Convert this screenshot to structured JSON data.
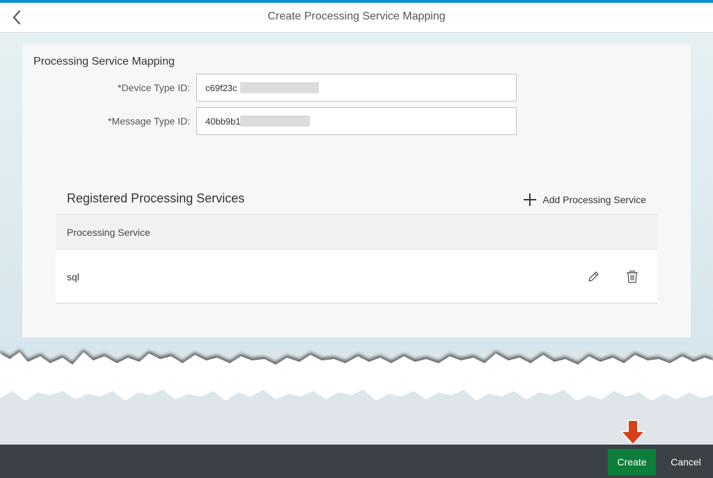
{
  "header": {
    "title": "Create Processing Service Mapping"
  },
  "section": {
    "title": "Processing Service Mapping"
  },
  "form": {
    "device_type": {
      "required_mark": "*",
      "label": "Device Type ID:",
      "value": "c69f23c"
    },
    "message_type": {
      "required_mark": "*",
      "label": "Message Type ID:",
      "value": "40bb9b1"
    }
  },
  "table": {
    "title": "Registered Processing Services",
    "add_label": "Add Processing Service",
    "columns": [
      "Processing Service"
    ],
    "rows": [
      {
        "service": "sql"
      }
    ]
  },
  "footer": {
    "create_label": "Create",
    "cancel_label": "Cancel"
  },
  "colors": {
    "accent": "#0a8fd6",
    "create_button": "#0d7d3a",
    "footer_bg": "#3c4148",
    "arrow": "#d8401a"
  },
  "icons": [
    "chevron-left-icon",
    "plus-icon",
    "pencil-icon",
    "trash-icon",
    "arrow-down-icon"
  ]
}
